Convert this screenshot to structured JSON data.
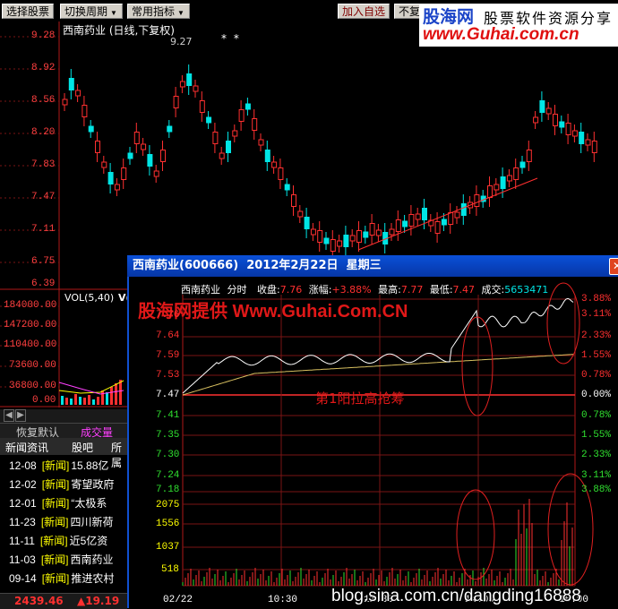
{
  "toolbar": {
    "buttons": [
      "选择股票",
      "切换周期",
      "常用指标"
    ],
    "add_watch": "加入自选",
    "cut_label": "不复"
  },
  "watermark": {
    "brand": "股海网",
    "tagline": "股票软件资源分享",
    "url": "www.Guhai.com.cn"
  },
  "main_chart": {
    "title": "西南药业 (日线,下复权)",
    "price_labels": [
      "9.28",
      "8.92",
      "8.56",
      "8.20",
      "7.83",
      "7.47",
      "7.11",
      "6.75",
      "6.39"
    ],
    "high_marker": "9.27",
    "stars": "* *"
  },
  "vol_panel": {
    "title": "VOL(5,40)",
    "title_tail": "V(",
    "labels": [
      "184000.00",
      "147200.00",
      "110400.00",
      "73600.00",
      "36800.00",
      "0.00"
    ]
  },
  "bottom_left": {
    "tab_restore": "恢复默认",
    "tab_volume": "成交量",
    "news_tabs": [
      "新闻资讯",
      "股吧",
      "所属"
    ],
    "news": [
      {
        "date": "12-08",
        "tag": "[新闻]",
        "text": "15.88亿"
      },
      {
        "date": "12-02",
        "tag": "[新闻]",
        "text": "寄望政府"
      },
      {
        "date": "12-01",
        "tag": "[新闻]",
        "text": "“太极系"
      },
      {
        "date": "11-23",
        "tag": "[新闻]",
        "text": "四川新荷"
      },
      {
        "date": "11-11",
        "tag": "[新闻]",
        "text": "近5亿资"
      },
      {
        "date": "11-03",
        "tag": "[新闻]",
        "text": "西南药业"
      },
      {
        "date": "09-14",
        "tag": "[新闻]",
        "text": "推进农村"
      }
    ],
    "index_value": "2439.46",
    "index_change": "▲19.19"
  },
  "intraday": {
    "window_title": "西南药业(600666)  2012年2月22日  星期三",
    "info": {
      "name": "西南药业",
      "kind": "分时",
      "close_label": "收盘:",
      "close": "7.76",
      "change_label": "涨幅:",
      "change": "+3.88%",
      "high_label": "最高:",
      "high": "7.77",
      "low_label": "最低:",
      "low": "7.47",
      "volume_label": "成交:",
      "volume": "5653471"
    },
    "watermark": "股海网提供 Www.Guhai.Com.CN",
    "annotation": "第1阳拉高抢筹",
    "price_axis": [
      "7.76",
      "7.64",
      "7.59",
      "7.53",
      "7.47",
      "7.41",
      "7.35",
      "7.30",
      "7.24",
      "7.18"
    ],
    "pct_axis": [
      "3.88%",
      "3.11%",
      "2.33%",
      "1.55%",
      "0.78%",
      "0.00%",
      "0.78%",
      "1.55%",
      "2.33%",
      "3.11%",
      "3.88%"
    ],
    "vol_axis": [
      "2075",
      "1556",
      "1037",
      "518"
    ],
    "time_axis": [
      "02/22",
      "10:30",
      "11:30",
      "14:00",
      "15:00"
    ]
  },
  "footer": {
    "blog": "blog.sina.com.cn/dangding16888"
  },
  "colors": {
    "up": "#ff3030",
    "down": "#00e5e5",
    "grid": "#b01818",
    "accent_yellow": "#ffff00"
  }
}
